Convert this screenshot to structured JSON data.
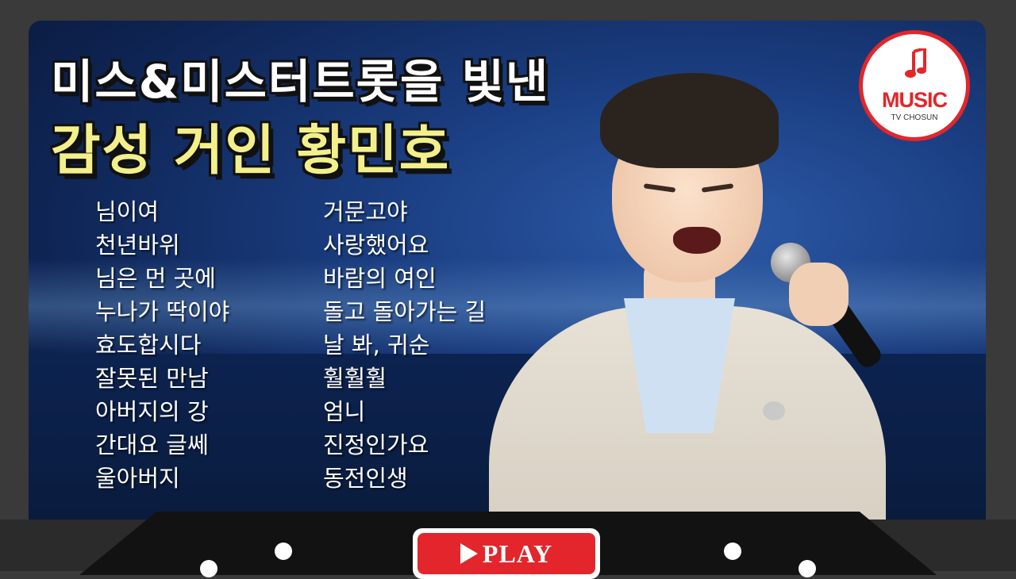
{
  "title": {
    "line1": "미스&미스터트롯을 빛낸",
    "line2": "감성 거인 황민호"
  },
  "songs": {
    "left": [
      "님이여",
      "천년바위",
      "님은 먼 곳에",
      "누나가 딱이야",
      "효도합시다",
      "잘못된 만남",
      "아버지의 강",
      "간대요 글쎄",
      "울아버지"
    ],
    "right": [
      "거문고야",
      "사랑했어요",
      "바람의 여인",
      "돌고 돌아가는 길",
      "날 봐, 귀순",
      "훨훨훨",
      "엄니",
      "진정인가요",
      "동전인생"
    ]
  },
  "logo": {
    "brand": "MUSIC",
    "sub": "TV CHOSUN",
    "icon": "music-note-icon"
  },
  "player": {
    "play_label": "PLAY",
    "play_icon": "play-icon"
  },
  "colors": {
    "accent_red": "#e2262b",
    "title_yellow": "#f3f08c",
    "background_blue": "#1a3d80"
  }
}
